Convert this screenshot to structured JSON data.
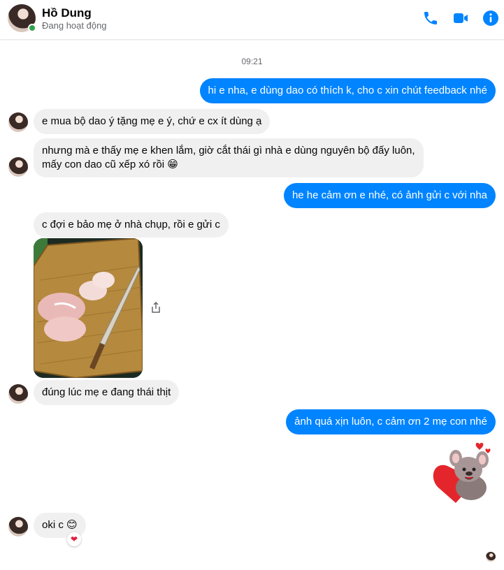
{
  "header": {
    "contact_name": "Hồ Dung",
    "status": "Đang hoạt động",
    "icons": [
      "phone-icon",
      "video-icon",
      "info-icon"
    ],
    "accent_color": "#0084ff"
  },
  "conversation": {
    "timestamp": "09:21",
    "messages": [
      {
        "direction": "outgoing",
        "text": "hi e nha, e dùng dao có thích k, cho c xin chút feedback nhé"
      },
      {
        "direction": "incoming",
        "text": "e mua bộ dao ý tặng mẹ e ý, chứ e cx ít dùng ạ"
      },
      {
        "direction": "incoming",
        "text_line1": "nhưng mà e thấy mẹ e khen lắm, giờ cắt thái gì nhà e dùng nguyên bộ đấy luôn,",
        "text_line2": "mấy con dao cũ xếp xó rồi 😁"
      },
      {
        "direction": "outgoing",
        "text": "he he cảm ơn e nhé, có ảnh gửi c với nha"
      },
      {
        "direction": "incoming",
        "text": "c đợi e bảo mẹ ở nhà chụp, rồi e gửi c"
      },
      {
        "direction": "incoming",
        "type": "photo",
        "content": "knife-on-cutting-board-photo"
      },
      {
        "direction": "incoming",
        "text": "đúng lúc mẹ e đang thái thịt"
      },
      {
        "direction": "outgoing",
        "text": "ảnh quá xịn luôn, c cảm ơn 2 mẹ con nhé"
      },
      {
        "direction": "outgoing",
        "type": "sticker",
        "content": "mouse-with-heart-sticker"
      },
      {
        "direction": "incoming",
        "text": "oki c 😊",
        "reaction": "❤"
      }
    ]
  },
  "colors": {
    "outgoing_bubble": "#0084ff",
    "incoming_bubble": "#f0f0f0",
    "online": "#31a24c"
  }
}
